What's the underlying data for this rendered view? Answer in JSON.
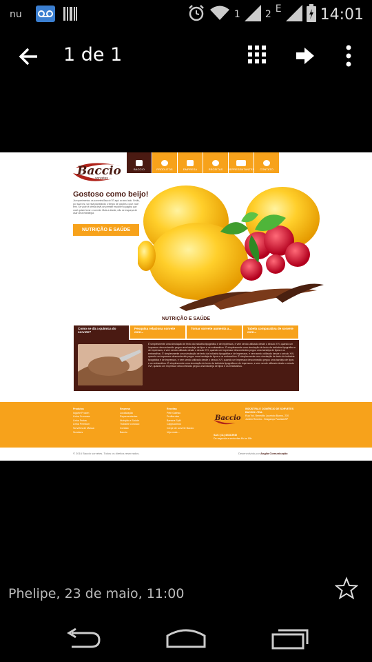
{
  "status_bar": {
    "time": "14:01",
    "sim1": "1",
    "sim2": "2",
    "net_type": "E",
    "icons": [
      "nu-icon",
      "voicemail-icon",
      "barcode-icon",
      "alarm-icon",
      "wifi-icon",
      "signal-icon",
      "battery-icon"
    ]
  },
  "app_bar": {
    "title": "1 de 1",
    "icons": [
      "back-arrow-icon",
      "grid-icon",
      "share-arrow-icon",
      "more-vert-icon"
    ]
  },
  "website": {
    "logo_text": "Baccio",
    "logo_sub": "sorvetes",
    "nav": [
      {
        "label": "BACCIO"
      },
      {
        "label": "PRODUTOS"
      },
      {
        "label": "EMPRESA"
      },
      {
        "label": "RECEITAS"
      },
      {
        "label": "REPRESENTANTES"
      },
      {
        "label": "CONTATO"
      }
    ],
    "hero_title": "Gostoso como beijo!",
    "hero_text": "Já experimentou os sorvetes Baccio? É aqui ao seu lado. Então, por sua vez, só está planejando o tempo de opções o que você tem. Se você lê oferta deve-se permitir escolher a página que você quiser levar o sorvete. Mais a diante, não se esqueça de usar uma estratégia.",
    "hero_button": "NUTRIÇÃO E SAÚDE",
    "section_title": "NUTRIÇÃO E SAÚDE",
    "tabs": [
      {
        "label": "Como se dá a química do sorvete?"
      },
      {
        "label": "Pesquisa relaciona sorvete com..."
      },
      {
        "label": "Tomar sorvete aumenta a..."
      },
      {
        "label": "Tabela comparativa de sorvete com..."
      }
    ],
    "content_text": "É simplesmente uma simulação de texto da indústria tipográfica e de impressos, e vem sendo utilizado desde o século XVI, quando um impressor desconhecido pegou uma bandeja de tipos e os embaralhou. É simplesmente uma simulação de texto da indústria tipográfica e de impressos, e vem sendo utilizado desde o século XVI, quando um impressor desconhecido pegou uma bandeja de tipos e os embaralhou. É simplesmente uma simulação de texto da indústria tipográfica e de impressos, e vem sendo utilizado desde o século XVI, quando um impressor desconhecido pegou uma bandeja de tipos e os embaralhou. É simplesmente uma simulação de texto da indústria tipográfica e de impressos, e vem sendo utilizado desde o século XVI, quando um impressor desconhecido pegou uma bandeja de tipos e os embaralhou. É simplesmente uma simulação de texto da indústria tipográfica e de impressos, e vem sendo utilizado desde o século XVI, quando um impressor desconhecido pegou uma bandeja de tipos e os embaralhou.",
    "footer": {
      "col1": [
        "Produtos",
        "Iogurte Frozen",
        "Linha Cremosa",
        "Linha Frutas",
        "Linha Premium",
        "Sorvetes de Massa",
        "Sundaes"
      ],
      "col2": [
        "Empresa",
        "Localização",
        "Representantes",
        "Nutrição e Saúde",
        "Trabalhe conosco",
        "Contato",
        "Baccio"
      ],
      "col3": [
        "Receitas",
        "Petit Gateau",
        "Profiteroles",
        "Banana Split",
        "Cappuccinos",
        "Crepe de sorvete Baccio",
        "Veja mais..."
      ],
      "company_name": "INDÚSTRIA E COMÉRCIO DE SORVETES BACCIO LTDA.",
      "address": "Rua Vol. Benedito Laurindo Bueno, 230 Jardim Recreio - Bragança Paulista/SP",
      "phone": "SAC: (11) 4033-5940",
      "hours": "De segunda a sexta das 8h às 18h",
      "copyright": "© 2016 Baccio sorvetes. Todos os direitos reservados.",
      "credit_prefix": "Desenvolvido por",
      "credit_name": "Anglia Comunicação"
    }
  },
  "caption": "Phelipe, 23 de maio, 11:00",
  "caption_icon": "star-outline-icon",
  "navbar_icons": [
    "nav-back-icon",
    "nav-home-icon",
    "nav-recent-icon"
  ],
  "colors": {
    "brand_orange": "#f7a21b",
    "brand_brown": "#4a1a12"
  }
}
